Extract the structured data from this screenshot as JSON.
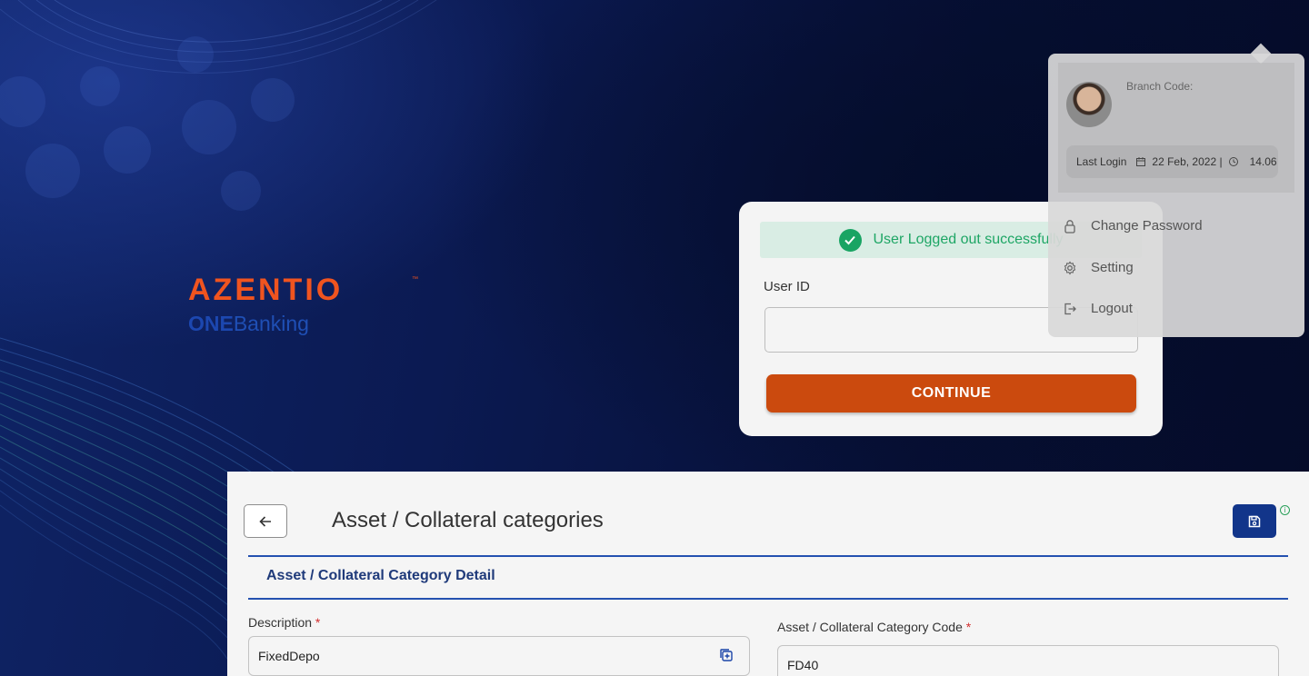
{
  "branding": {
    "logo_main": "AZENTIO",
    "logo_tm": "™",
    "logo_sub_bold": "ONE",
    "logo_sub_light": "Banking"
  },
  "toast": {
    "message": "User Logged out successfully",
    "icon": "check-circle-icon",
    "color": "#1ea665"
  },
  "login": {
    "userid_label": "User ID",
    "userid_value": "",
    "continue_label": "CONTINUE",
    "button_color": "#cb4a0e"
  },
  "profile": {
    "branch_code_label": "Branch Code:",
    "last_login_label": "Last Login",
    "last_login_date": "22 Feb, 2022 |",
    "last_login_time": "14.06",
    "menu": [
      {
        "label": "Change Password",
        "icon": "lock-icon"
      },
      {
        "label": "Setting",
        "icon": "gear-icon"
      },
      {
        "label": "Logout",
        "icon": "logout-icon"
      }
    ]
  },
  "form": {
    "title": "Asset / Collateral categories",
    "section_title": "Asset / Collateral Category Detail",
    "description_label": "Description",
    "description_value": "FixedDepo",
    "code_label": "Asset / Collateral Category Code",
    "code_value": "FD40",
    "required_mark": "*",
    "info_mark": "i",
    "accent_color": "#12358a"
  }
}
